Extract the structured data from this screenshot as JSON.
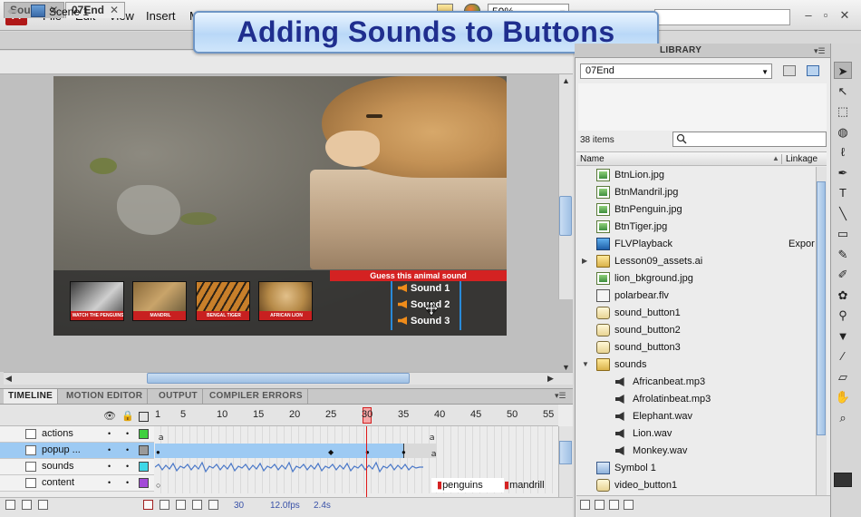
{
  "app": {
    "logo": "Fl"
  },
  "menu": [
    "File",
    "Edit",
    "View",
    "Insert",
    "M"
  ],
  "window_controls": [
    "–",
    "▫",
    "✕"
  ],
  "banner": {
    "title": "Adding Sounds to Buttons"
  },
  "doc_tabs": [
    {
      "label": "Sound",
      "close": "✕",
      "active": false
    },
    {
      "label": "07End",
      "close": "✕",
      "active": true
    }
  ],
  "scene": {
    "label": "Scene 1",
    "zoom": "50%"
  },
  "stage": {
    "guess_title": "Guess this animal sound",
    "thumbnails": [
      {
        "caption": "WATCH THE PENGUINS",
        "colors": [
          "#3a3a3a",
          "#cfcfcf"
        ]
      },
      {
        "caption": "MANDRIL",
        "colors": [
          "#8a6a3a",
          "#c9a46a"
        ]
      },
      {
        "caption": "BENGAL TIGER",
        "colors": [
          "#b8742a",
          "#3a5a2a"
        ]
      },
      {
        "caption": "AFRICAN LION",
        "colors": [
          "#b68a48",
          "#e2c08a"
        ]
      }
    ],
    "sound_buttons": [
      "Sound 1",
      "Sound 2",
      "Sound 3"
    ]
  },
  "panel_tabs": [
    "TIMELINE",
    "MOTION EDITOR",
    "OUTPUT",
    "COMPILER ERRORS"
  ],
  "timeline": {
    "frame_numbers": [
      "1",
      "5",
      "10",
      "15",
      "20",
      "25",
      "30",
      "35",
      "40",
      "45",
      "50",
      "55"
    ],
    "layers": [
      {
        "name": "actions",
        "color": "#3fd03f",
        "selected": false
      },
      {
        "name": "popup ...",
        "color": "#9a9a9a",
        "selected": true
      },
      {
        "name": "sounds",
        "color": "#3fd8e8",
        "selected": false
      },
      {
        "name": "content",
        "color": "#a34ad8",
        "selected": false
      }
    ],
    "frame_labels": [
      "penguins",
      "mandrill"
    ],
    "footer": {
      "current_frame": "30",
      "fps": "12.0",
      "fps_unit": "fps",
      "time": "2.4s"
    }
  },
  "library": {
    "tab_label": "LIBRARY",
    "document": "07End",
    "item_count": "38 items",
    "columns": {
      "name": "Name",
      "linkage": "Linkage"
    },
    "items": [
      {
        "name": "BtnLion.jpg",
        "icon": "image",
        "indent": 1,
        "linkage": ""
      },
      {
        "name": "BtnMandril.jpg",
        "icon": "image",
        "indent": 1,
        "linkage": ""
      },
      {
        "name": "BtnPenguin.jpg",
        "icon": "image",
        "indent": 1,
        "linkage": ""
      },
      {
        "name": "BtnTiger.jpg",
        "icon": "image",
        "indent": 1,
        "linkage": ""
      },
      {
        "name": "FLVPlayback",
        "icon": "video",
        "indent": 1,
        "linkage": "Expor"
      },
      {
        "name": "Lesson09_assets.ai",
        "icon": "folder",
        "indent": 1,
        "linkage": "",
        "tri": "▶"
      },
      {
        "name": "lion_bkground.jpg",
        "icon": "image",
        "indent": 1,
        "linkage": ""
      },
      {
        "name": "polarbear.flv",
        "icon": "flv",
        "indent": 1,
        "linkage": ""
      },
      {
        "name": "sound_button1",
        "icon": "button",
        "indent": 1,
        "linkage": ""
      },
      {
        "name": "sound_button2",
        "icon": "button",
        "indent": 1,
        "linkage": ""
      },
      {
        "name": "sound_button3",
        "icon": "button",
        "indent": 1,
        "linkage": ""
      },
      {
        "name": "sounds",
        "icon": "folder",
        "indent": 1,
        "linkage": "",
        "tri": "▼"
      },
      {
        "name": "Africanbeat.mp3",
        "icon": "sound",
        "indent": 2,
        "linkage": ""
      },
      {
        "name": "Afrolatinbeat.mp3",
        "icon": "sound",
        "indent": 2,
        "linkage": ""
      },
      {
        "name": "Elephant.wav",
        "icon": "sound",
        "indent": 2,
        "linkage": ""
      },
      {
        "name": "Lion.wav",
        "icon": "sound",
        "indent": 2,
        "linkage": ""
      },
      {
        "name": "Monkey.wav",
        "icon": "sound",
        "indent": 2,
        "linkage": ""
      },
      {
        "name": "Symbol 1",
        "icon": "symbol",
        "indent": 1,
        "linkage": ""
      },
      {
        "name": "video_button1",
        "icon": "button",
        "indent": 1,
        "linkage": ""
      }
    ]
  },
  "tools": [
    "arrow-tool",
    "subselect-tool",
    "free-transform-tool",
    "3d-rotation-tool",
    "lasso-tool",
    "pen-tool",
    "text-tool",
    "line-tool",
    "rectangle-tool",
    "pencil-tool",
    "brush-tool",
    "deco-tool",
    "bone-tool",
    "paint-bucket-tool",
    "eyedropper-tool",
    "eraser-tool",
    "hand-tool",
    "zoom-tool",
    "stroke-color-tool"
  ],
  "tool_glyphs": [
    "➤",
    "↖",
    "⬚",
    "◍",
    "ℓ",
    "✒",
    "T",
    "╲",
    "▭",
    "✎",
    "✐",
    "✿",
    "⚲",
    "▼",
    "⁄",
    "▱",
    "✋",
    "⌕",
    "⁄"
  ]
}
